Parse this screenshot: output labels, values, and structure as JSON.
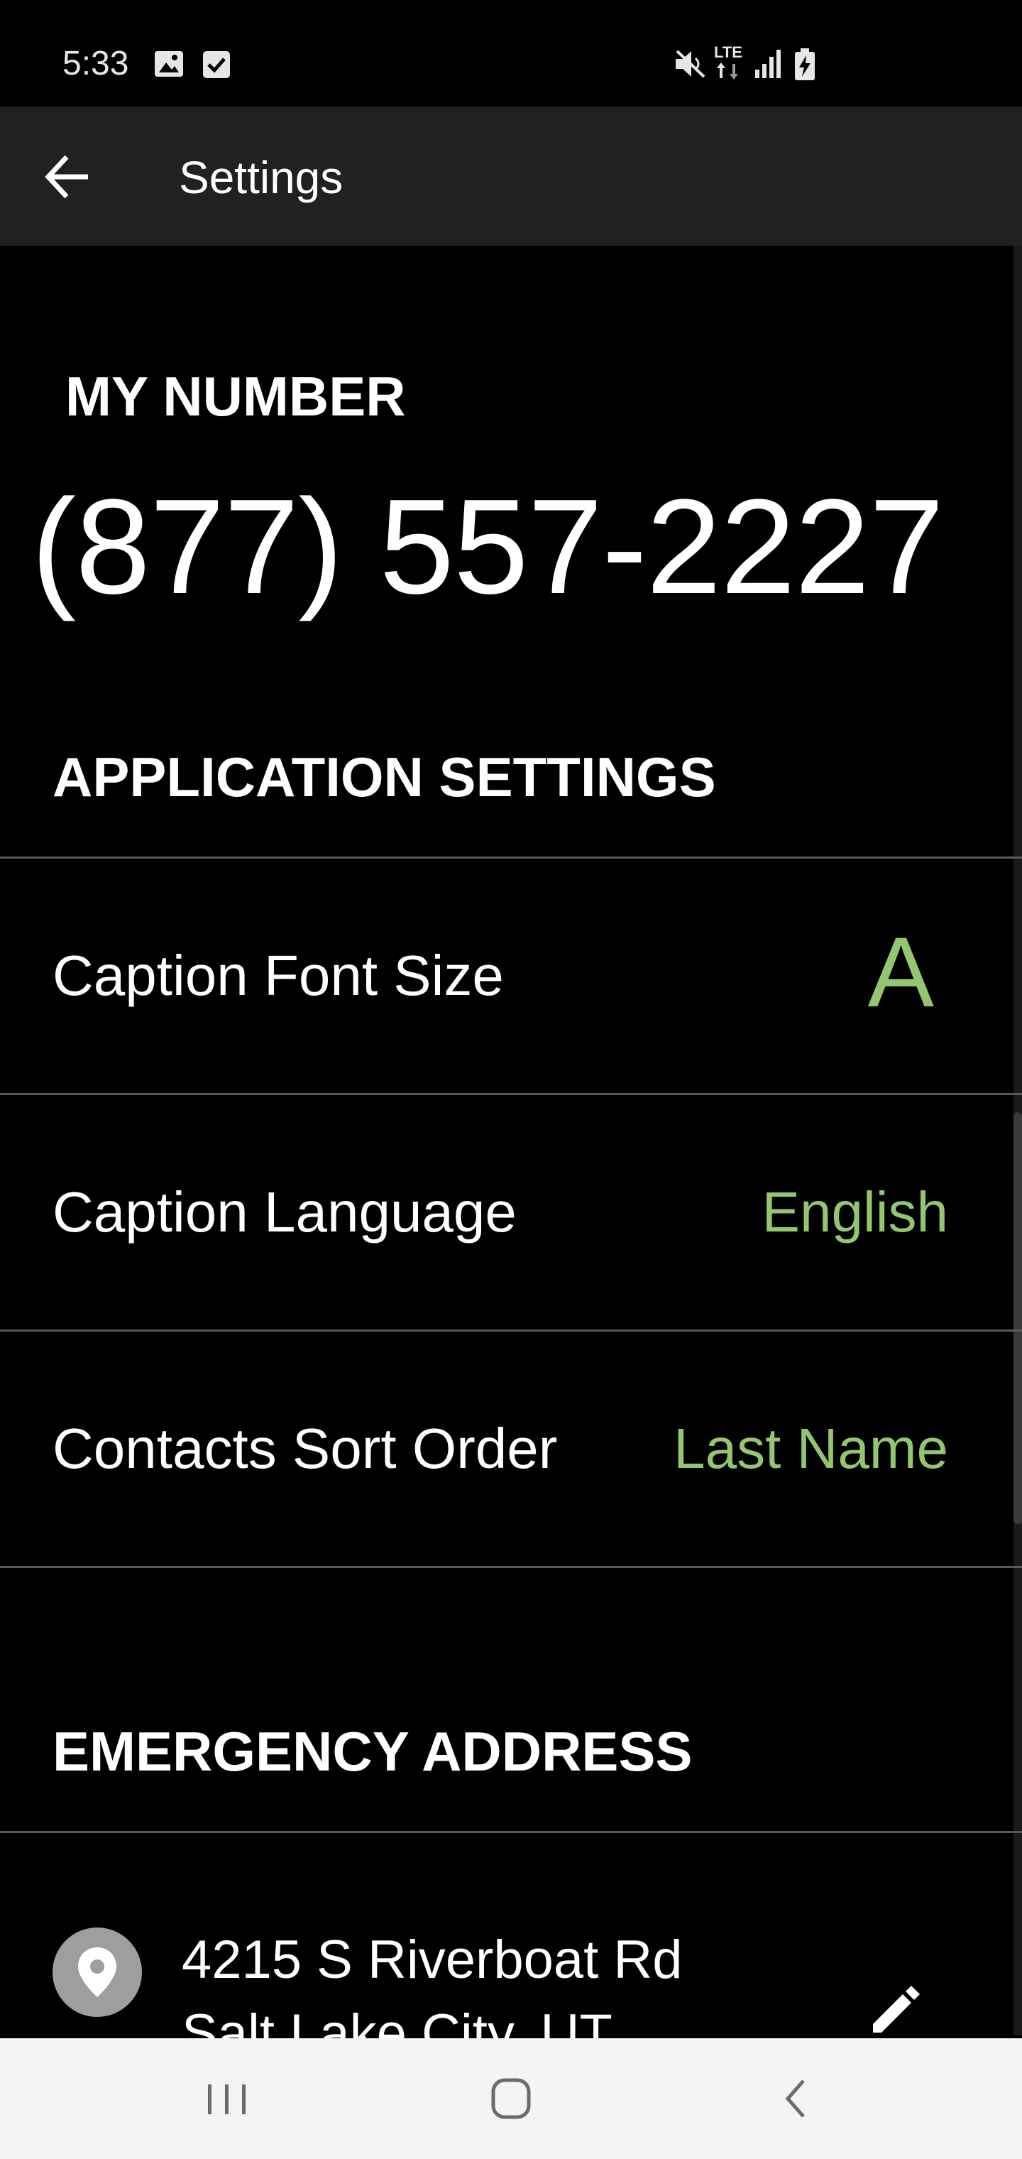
{
  "status_bar": {
    "time": "5:33",
    "icons": [
      "gallery-icon",
      "task-check-icon",
      "mute-icon",
      "lte-icon",
      "signal-icon",
      "battery-charging-icon"
    ],
    "lte_label": "LTE"
  },
  "app_bar": {
    "back_icon": "arrow-left-icon",
    "title": "Settings"
  },
  "my_number": {
    "heading": "MY NUMBER",
    "value": "(877) 557-2227"
  },
  "application_settings": {
    "heading": "APPLICATION SETTINGS",
    "items": [
      {
        "label": "Caption Font Size",
        "value": "A"
      },
      {
        "label": "Caption Language",
        "value": "English"
      },
      {
        "label": "Contacts Sort Order",
        "value": "Last Name"
      }
    ]
  },
  "emergency_address": {
    "heading": "EMERGENCY ADDRESS",
    "pin_icon": "location-pin-icon",
    "line1": "4215 S Riverboat Rd",
    "line2": "Salt Lake City, UT",
    "edit_icon": "pencil-icon"
  },
  "nav_bar": {
    "icons": [
      "recent-apps-icon",
      "home-icon",
      "back-icon"
    ]
  },
  "colors": {
    "accent": "#94c66f",
    "background": "#000000",
    "app_bar": "#212121",
    "nav_bar": "#f4f4f4"
  }
}
